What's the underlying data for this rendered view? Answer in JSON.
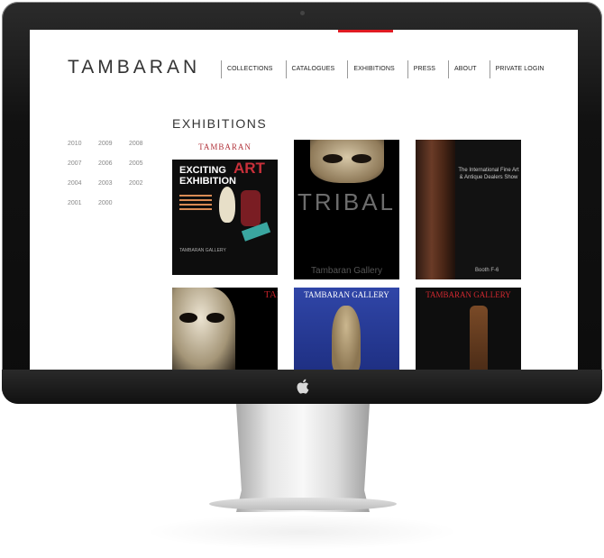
{
  "site": {
    "logo": "TAMBARAN",
    "nav": [
      "COLLECTIONS",
      "CATALOGUES",
      "EXHIBITIONS",
      "PRESS",
      "ABOUT",
      "PRIVATE LOGIN"
    ],
    "active_nav": "EXHIBITIONS",
    "accent_color": "#e01b22"
  },
  "page": {
    "title": "EXHIBITIONS"
  },
  "years": [
    "2010",
    "2009",
    "2008",
    "2007",
    "2006",
    "2005",
    "2004",
    "2003",
    "2002",
    "2001",
    "2000"
  ],
  "tiles": {
    "t1": {
      "brand": "TAMBARAN",
      "head1": "EXCITING",
      "art": "ART",
      "head2": "EXHIBITION",
      "footer": "TAMBARAN GALLERY"
    },
    "t2": {
      "word": "TRIBAL",
      "gallery": "Tambaran Gallery"
    },
    "t3": {
      "fair": "The International Fine Art & Antique Dealers Show",
      "booth": "Booth F-6"
    },
    "t4": {
      "vertical": "TAMBA"
    },
    "t5": {
      "title": "TAMBARAN GALLERY"
    },
    "t6": {
      "title": "TAMBARAN GALLERY"
    }
  }
}
